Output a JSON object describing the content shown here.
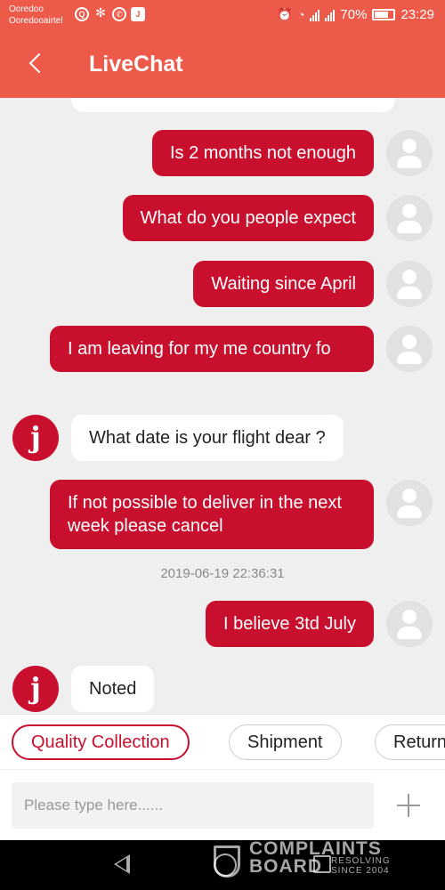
{
  "status_bar": {
    "carrier_1": "Ooredoo",
    "carrier_2": "Ooredooairtel",
    "battery": "70%",
    "time": "23:29",
    "notif_icons": [
      "search-icon",
      "pinwheel-icon",
      "whatsapp-icon",
      "j-app-icon"
    ]
  },
  "header": {
    "title": "LiveChat"
  },
  "messages": [
    {
      "from": "user",
      "text": "Is 2 months not enough"
    },
    {
      "from": "user",
      "text": "What do you people expect"
    },
    {
      "from": "user",
      "text": "Waiting since April"
    },
    {
      "from": "user",
      "text": "I am leaving for my me country fo"
    },
    {
      "from": "agent",
      "avatar_letter": "j",
      "text": "What date is your flight dear ?"
    },
    {
      "from": "user",
      "text": "If not possible to deliver in the next week please cancel"
    },
    {
      "from": "system",
      "text": "2019-06-19 22:36:31"
    },
    {
      "from": "user",
      "text": "I believe 3td July"
    },
    {
      "from": "agent",
      "avatar_letter": "j",
      "text": "Noted"
    }
  ],
  "quick_replies": [
    "Quality Collection",
    "Shipment",
    "Return"
  ],
  "composer": {
    "placeholder": "Please type here......"
  },
  "watermark": {
    "line1": "COMPLAINTS",
    "line2": "BOARD",
    "tag1": "RESOLVING",
    "tag2": "SINCE 2004"
  },
  "colors": {
    "header": "#ee5a4a",
    "accent": "#c8102e",
    "background": "#efefef"
  }
}
